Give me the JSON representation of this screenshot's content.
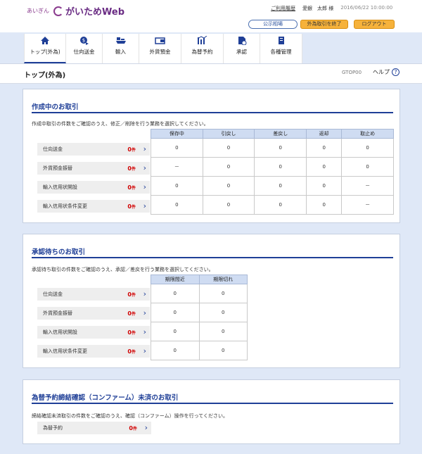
{
  "header": {
    "logo_sub": "あいぎん",
    "logo_name": "がいためWeb",
    "usage_history": "ご利用履歴",
    "user": "愛銀　太郎 様",
    "datetime": "2016/06/22 10:00:00",
    "rates_button": "公示相場",
    "end_button": "外為取引を終了",
    "logout_button": "ログアウト"
  },
  "nav": [
    {
      "label": "トップ(外為)",
      "icon": "home-icon"
    },
    {
      "label": "仕向送金",
      "icon": "remittance-icon"
    },
    {
      "label": "輸入",
      "icon": "import-icon"
    },
    {
      "label": "外貨預金",
      "icon": "deposit-icon"
    },
    {
      "label": "為替予約",
      "icon": "exchange-icon"
    },
    {
      "label": "承認",
      "icon": "approval-icon"
    },
    {
      "label": "各種管理",
      "icon": "management-icon"
    }
  ],
  "page": {
    "title": "トップ(外為)",
    "code": "GTOP00",
    "help": "ヘルプ"
  },
  "drafting": {
    "title": "作成中のお取引",
    "description": "作成中取引の件数をご確認のうえ、修正／削除を行う業務を選択してください。",
    "columns": [
      "保存中",
      "引戻し",
      "差戻し",
      "返却",
      "取止め"
    ],
    "rows": [
      {
        "name": "仕向送金",
        "count": "0",
        "unit": "件",
        "values": [
          "0",
          "0",
          "0",
          "0",
          "0"
        ]
      },
      {
        "name": "外貨預金振替",
        "count": "0",
        "unit": "件",
        "values": [
          "－",
          "0",
          "0",
          "0",
          "0"
        ]
      },
      {
        "name": "輸入信用状開設",
        "count": "0",
        "unit": "件",
        "values": [
          "0",
          "0",
          "0",
          "0",
          "－"
        ]
      },
      {
        "name": "輸入信用状条件変更",
        "count": "0",
        "unit": "件",
        "values": [
          "0",
          "0",
          "0",
          "0",
          "－"
        ]
      }
    ]
  },
  "approval": {
    "title": "承認待ちのお取引",
    "description": "承認待ち取引の件数をご確認のうえ、承認／差戻を行う業務を選択してください。",
    "columns": [
      "期限間近",
      "期限切れ"
    ],
    "rows": [
      {
        "name": "仕向送金",
        "count": "0",
        "unit": "件",
        "values": [
          "0",
          "0"
        ]
      },
      {
        "name": "外貨預金振替",
        "count": "0",
        "unit": "件",
        "values": [
          "0",
          "0"
        ]
      },
      {
        "name": "輸入信用状開設",
        "count": "0",
        "unit": "件",
        "values": [
          "0",
          "0"
        ]
      },
      {
        "name": "輸入信用状条件変更",
        "count": "0",
        "unit": "件",
        "values": [
          "0",
          "0"
        ]
      }
    ]
  },
  "confirmed": {
    "title": "為替予約締結確認（コンファーム）未済のお取引",
    "description": "締結確認未済取引の件数をご確認のうえ、確認（コンファーム）操作を行ってください。",
    "rows": [
      {
        "name": "為替予約",
        "count": "0",
        "unit": "件"
      }
    ]
  }
}
